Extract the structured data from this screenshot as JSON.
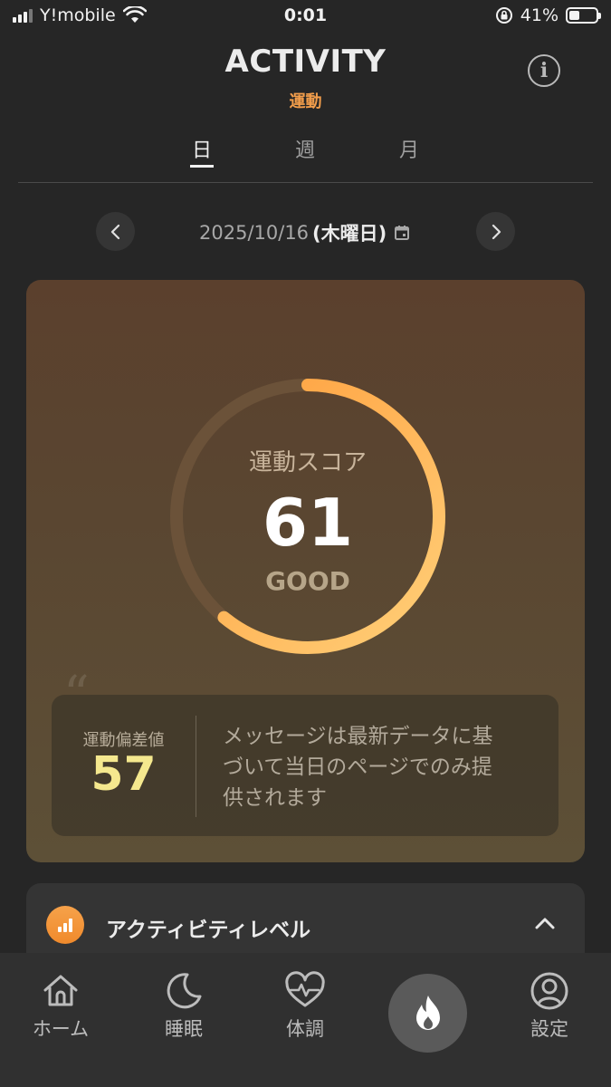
{
  "status_bar": {
    "carrier": "Y!mobile",
    "time": "0:01",
    "battery": "41%",
    "battery_level": 0.41
  },
  "header": {
    "title": "ACTIVITY",
    "subtitle": "運動"
  },
  "tabs": [
    {
      "label": "日",
      "active": true
    },
    {
      "label": "週",
      "active": false
    },
    {
      "label": "月",
      "active": false
    }
  ],
  "date_nav": {
    "date": "2025/10/16",
    "weekday": "(木曜日)"
  },
  "score": {
    "label": "運動スコア",
    "value": "61",
    "grade": "GOOD",
    "progress": 0.61
  },
  "deviation": {
    "label": "運動偏差値",
    "value": "57"
  },
  "message": "メッセージは最新データに基づいて当日のページでのみ提供されます",
  "activity_level": {
    "title": "アクティビティレベル"
  },
  "bottom_nav": {
    "items": [
      {
        "label": "ホーム",
        "icon": "home-icon"
      },
      {
        "label": "睡眠",
        "icon": "moon-icon"
      },
      {
        "label": "体調",
        "icon": "heart-pulse-icon"
      },
      {
        "label": "設定",
        "icon": "user-circle-icon"
      }
    ],
    "fab_icon": "flame-icon"
  },
  "colors": {
    "accent": "#f29d4b",
    "deviation": "#f5e88e",
    "gauge_start": "#ffcf78",
    "gauge_end": "#ff9c3a"
  }
}
